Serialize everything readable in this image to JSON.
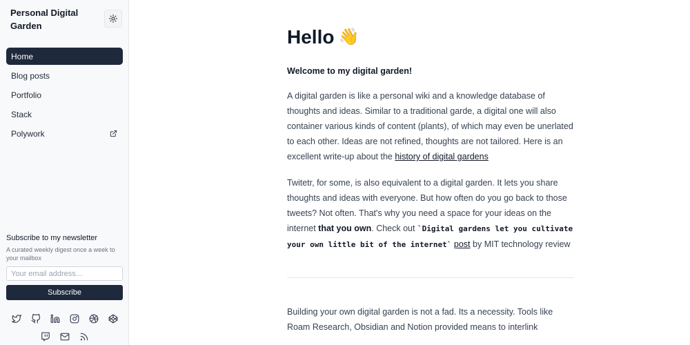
{
  "sidebar": {
    "brand": "Personal Digital Garden",
    "theme_toggle_icon": "sun-icon",
    "nav": [
      {
        "label": "Home",
        "active": true
      },
      {
        "label": "Blog posts",
        "active": false
      },
      {
        "label": "Portfolio",
        "active": false
      },
      {
        "label": "Stack",
        "active": false
      },
      {
        "label": "Polywork",
        "active": false,
        "icon": "external-link-icon"
      }
    ],
    "newsletter": {
      "title": "Subscribe to my newsletter",
      "description": "A curated weekly digest once a week to your mailbox",
      "placeholder": "Your email address...",
      "button": "Subscribe"
    },
    "social_icons": [
      "twitter-icon",
      "github-icon",
      "linkedin-icon",
      "instagram-icon",
      "dribbble-icon",
      "codepen-icon",
      "twitch-icon",
      "mail-icon",
      "rss-icon"
    ]
  },
  "main": {
    "title": "Hello",
    "title_emoji": "👋",
    "lead": "Welcome to my digital garden!",
    "p1": {
      "text": "A digital garden is like a personal wiki and a knowledge database of thoughts and ideas. Similar to a traditional garde, a digital one will also container various kinds of content (plants), of which may even be unerlated to each other. Ideas are not refined, thoughts are not tailored. Here is an excellent write-up about the ",
      "link": "history of digital gardens"
    },
    "p2": {
      "text1": "Twitetr, for some, is also equivalent to a digital garden. It lets you share thoughts and ideas with everyone. But how often do you go back to those tweets? Not often. That's why you need a space for your ideas on the internet ",
      "bold": "that you own",
      "text2": ". Check out ",
      "code": "`Digital gardens let you cultivate your own little bit of the internet`",
      "link": "post",
      "text3": " by MIT technology review"
    },
    "p3": "Building your own digital garden is not a fad. Its a necessity. Tools like Roam Research, Obsidian and Notion provided means to interlink"
  },
  "colors": {
    "accent_dark": "#1e293b",
    "sidebar_bg": "#f8f9fb",
    "text": "#374151"
  }
}
